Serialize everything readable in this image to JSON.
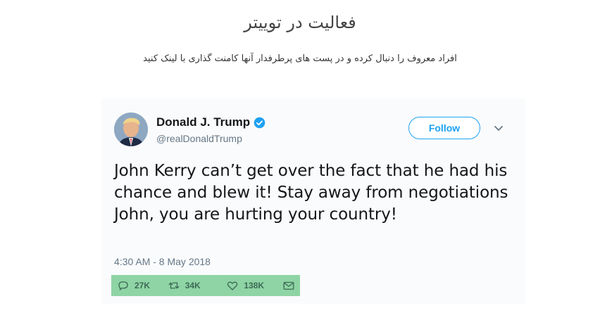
{
  "page": {
    "heading": "فعالیت در توییتر",
    "subheading": "افراد معروف را دنبال کرده و در پست های پرطرفدار آنها کامنت گذاری با لینک کنید"
  },
  "tweet": {
    "author_name": "Donald J. Trump",
    "handle": "@realDonaldTrump",
    "follow_label": "Follow",
    "text": "John Kerry can’t get over the fact that he had his chance and blew it! Stay away from negotiations John, you are hurting your country!",
    "timestamp": "4:30 AM - 8 May 2018",
    "replies": "27K",
    "retweets": "34K",
    "likes": "138K"
  },
  "colors": {
    "accent": "#1da1f2",
    "highlight": "#8fd4a4",
    "muted": "#657786"
  },
  "icons": [
    "verified-badge-icon",
    "chevron-down-icon",
    "reply-icon",
    "retweet-icon",
    "like-icon",
    "message-icon"
  ]
}
